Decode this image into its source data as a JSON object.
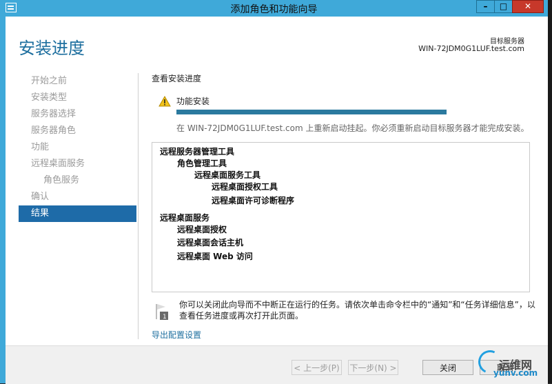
{
  "window": {
    "title": "添加角色和功能向导"
  },
  "header": {
    "page_title": "安装进度",
    "dest_label": "目标服务器",
    "dest_server": "WIN-72JDM0G1LUF.test.com"
  },
  "nav": {
    "items": [
      {
        "label": "开始之前"
      },
      {
        "label": "安装类型"
      },
      {
        "label": "服务器选择"
      },
      {
        "label": "服务器角色"
      },
      {
        "label": "功能"
      },
      {
        "label": "远程桌面服务"
      },
      {
        "label": "角色服务"
      },
      {
        "label": "确认"
      },
      {
        "label": "结果"
      }
    ]
  },
  "content": {
    "section_title": "查看安装进度",
    "feature_label": "功能安装",
    "progress": 1.0,
    "status_text": "在 WIN-72JDM0G1LUF.test.com 上重新启动挂起。你必须重新启动目标服务器才能完成安装。",
    "results": [
      "远程服务器管理工具",
      "角色管理工具",
      "远程桌面服务工具",
      "远程桌面授权工具",
      "远程桌面许可诊断程序",
      "远程桌面服务",
      "远程桌面授权",
      "远程桌面会话主机",
      "远程桌面 Web 访问"
    ],
    "note": "你可以关闭此向导而不中断正在运行的任务。请依次单击命令栏中的“通知”和“任务详细信息”，以查看任务进度或再次打开此页面。",
    "export_link": "导出配置设置"
  },
  "footer": {
    "prev_label": "< 上一步(P)",
    "next_label": "下一步(N) >",
    "close_label": "关闭",
    "cancel_label": "取消"
  },
  "watermark": {
    "text": "运维网",
    "sub": "yunv.com"
  },
  "colors": {
    "accent": "#1e6ba8",
    "titlebar": "#3fa9d9",
    "progress": "#2b7a9f"
  }
}
